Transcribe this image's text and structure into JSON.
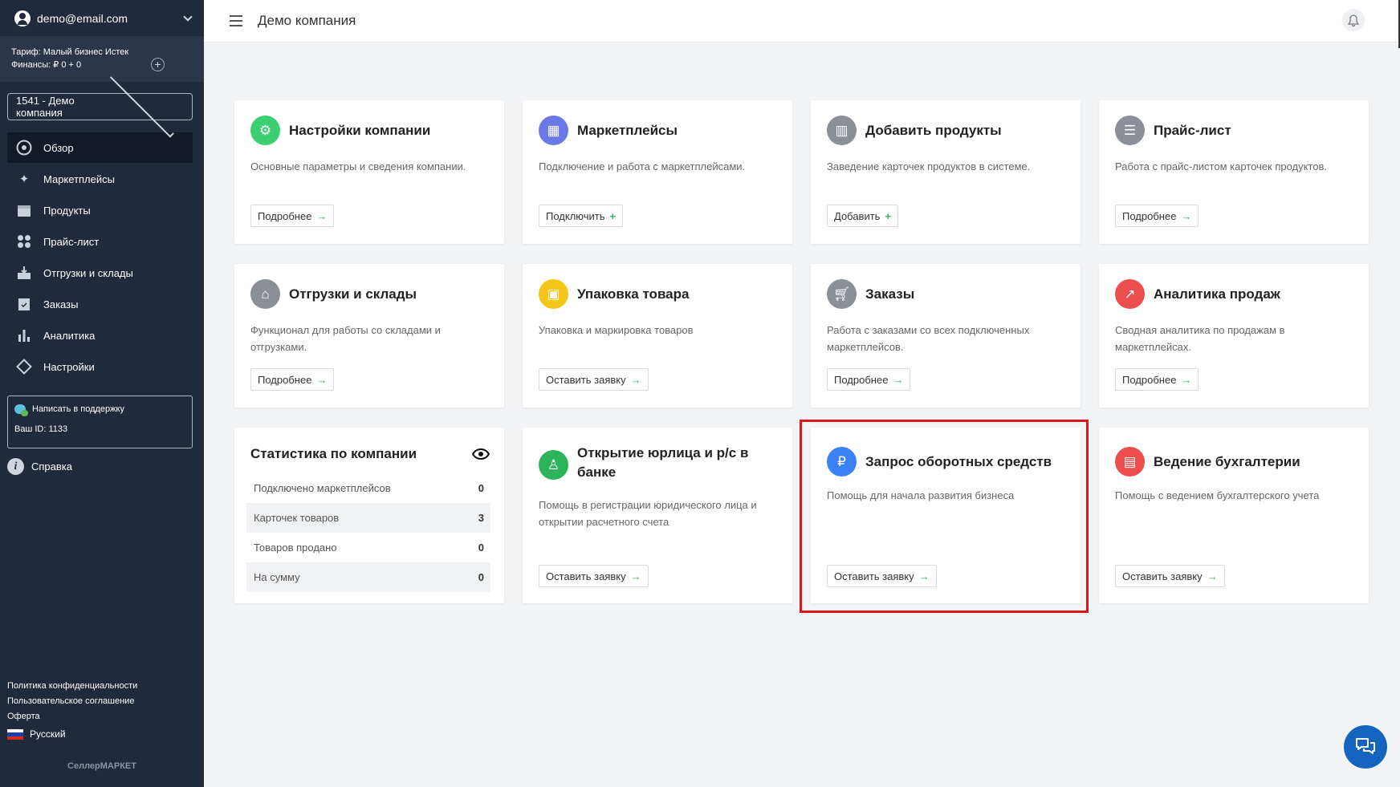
{
  "sidebar": {
    "account_email": "demo@email.com",
    "tariff_line": "Тариф: Малый бизнес Истек",
    "finance_line": "Финансы: ₽ 0 + 0",
    "company_select": "1541 - Демо компания",
    "menu": [
      {
        "label": "Обзор",
        "icon": "overview-icon",
        "active": true
      },
      {
        "label": "Маркетплейсы",
        "icon": "sparkles-icon"
      },
      {
        "label": "Продукты",
        "icon": "calendar-icon"
      },
      {
        "label": "Прайс-лист",
        "icon": "dots-icon"
      },
      {
        "label": "Отгрузки и склады",
        "icon": "inbox-download-icon"
      },
      {
        "label": "Заказы",
        "icon": "clipboard-check-icon"
      },
      {
        "label": "Аналитика",
        "icon": "bar-chart-icon"
      },
      {
        "label": "Настройки",
        "icon": "diamond-settings-icon"
      }
    ],
    "support_label": "Написать в поддержку",
    "user_id": "Ваш ID: 1133",
    "help_label": "Справка",
    "links": [
      "Политика конфиденциальности",
      "Пользовательское соглашение",
      "Оферта"
    ],
    "language": "Русский",
    "brand": "СеллерМАРКЕТ"
  },
  "topbar": {
    "title": "Демо компания"
  },
  "cards": {
    "company_settings": {
      "title": "Настройки компании",
      "desc": "Основные параметры и сведения компании.",
      "button": "Подробнее",
      "arrow": "→"
    },
    "marketplaces": {
      "title": "Маркетплейсы",
      "desc": "Подключение и работа с маркетплейсами.",
      "button": "Подключить",
      "arrow": "+"
    },
    "add_products": {
      "title": "Добавить продукты",
      "desc": "Заведение карточек продуктов в системе.",
      "button": "Добавить",
      "arrow": "+"
    },
    "price_list": {
      "title": "Прайс-лист",
      "desc": "Работа с прайс-листом карточек продуктов.",
      "button": "Подробнее",
      "arrow": "→"
    },
    "shipments": {
      "title": "Отгрузки и склады",
      "desc": "Функционал для работы со складами и отгрузками.",
      "button": "Подробнее",
      "arrow": "→"
    },
    "packaging": {
      "title": "Упаковка товара",
      "desc": "Упаковка и маркировка товаров",
      "button": "Оставить заявку",
      "arrow": "→"
    },
    "orders": {
      "title": "Заказы",
      "desc": "Работа с заказами со всех подключенных маркетплейсов.",
      "button": "Подробнее",
      "arrow": "→"
    },
    "sales_analytics": {
      "title": "Аналитика продаж",
      "desc": "Сводная аналитика по продажам в маркетплейсах.",
      "button": "Подробнее",
      "arrow": "→"
    },
    "legal_entity": {
      "title": "Открытие юрлица и р/с в банке",
      "desc": "Помощь в регистрации юридического лица и открытии расчетного счета",
      "button": "Оставить заявку",
      "arrow": "→"
    },
    "working_capital": {
      "title": "Запрос оборотных средств",
      "desc": "Помощь для начала развития бизнеса",
      "button": "Оставить заявку",
      "arrow": "→"
    },
    "accounting": {
      "title": "Ведение бухгалтерии",
      "desc": "Помощь с ведением бухгалтерского учета",
      "button": "Оставить заявку",
      "arrow": "→"
    }
  },
  "stats": {
    "title": "Статистика по компании",
    "rows": [
      {
        "label": "Подключено маркетплейсов",
        "value": "0"
      },
      {
        "label": "Карточек товаров",
        "value": "3"
      },
      {
        "label": "Товаров продано",
        "value": "0"
      },
      {
        "label": "На сумму",
        "value": "0"
      }
    ]
  },
  "colors": {
    "sidebar_bg": "#1f2a3a",
    "accent_green": "#2db35a",
    "highlight_red": "#e0151c",
    "chat_fab": "#1565c0"
  }
}
